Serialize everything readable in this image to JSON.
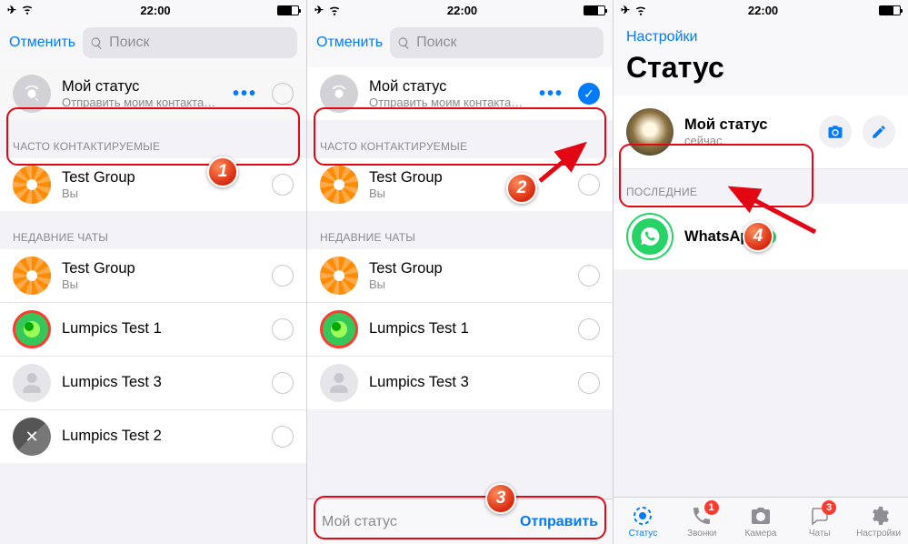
{
  "status_time": "22:00",
  "screen1": {
    "cancel": "Отменить",
    "search_placeholder": "Поиск",
    "my_status": {
      "title": "Мой статус",
      "subtitle": "Отправить моим контактам, кр…"
    },
    "section_frequent": "ЧАСТО КОНТАКТИРУЕМЫЕ",
    "frequent": [
      {
        "name": "Test Group",
        "sub": "Вы"
      }
    ],
    "section_recent": "НЕДАВНИЕ ЧАТЫ",
    "recent": [
      {
        "name": "Test Group",
        "sub": "Вы"
      },
      {
        "name": "Lumpics Test 1",
        "sub": ""
      },
      {
        "name": "Lumpics Test 3",
        "sub": ""
      },
      {
        "name": "Lumpics Test 2",
        "sub": ""
      }
    ]
  },
  "screen2": {
    "cancel": "Отменить",
    "search_placeholder": "Поиск",
    "my_status": {
      "title": "Мой статус",
      "subtitle": "Отправить моим контактам, кр…"
    },
    "section_frequent": "ЧАСТО КОНТАКТИРУЕМЫЕ",
    "frequent": [
      {
        "name": "Test Group",
        "sub": "Вы"
      }
    ],
    "section_recent": "НЕДАВНИЕ ЧАТЫ",
    "recent": [
      {
        "name": "Test Group",
        "sub": "Вы"
      },
      {
        "name": "Lumpics Test 1",
        "sub": ""
      },
      {
        "name": "Lumpics Test 3",
        "sub": ""
      }
    ],
    "footer_label": "Мой статус",
    "send": "Отправить"
  },
  "screen3": {
    "back": "Настройки",
    "title": "Статус",
    "my_status": {
      "title": "Мой статус",
      "subtitle": "сейчас"
    },
    "section_recent": "ПОСЛЕДНИЕ",
    "whatsapp": "WhatsApp",
    "tabs": {
      "status": "Статус",
      "calls": "Звонки",
      "calls_badge": "1",
      "camera": "Камера",
      "chats": "Чаты",
      "chats_badge": "3",
      "settings": "Настройки"
    }
  },
  "badges": {
    "b1": "1",
    "b2": "2",
    "b3": "3",
    "b4": "4"
  }
}
